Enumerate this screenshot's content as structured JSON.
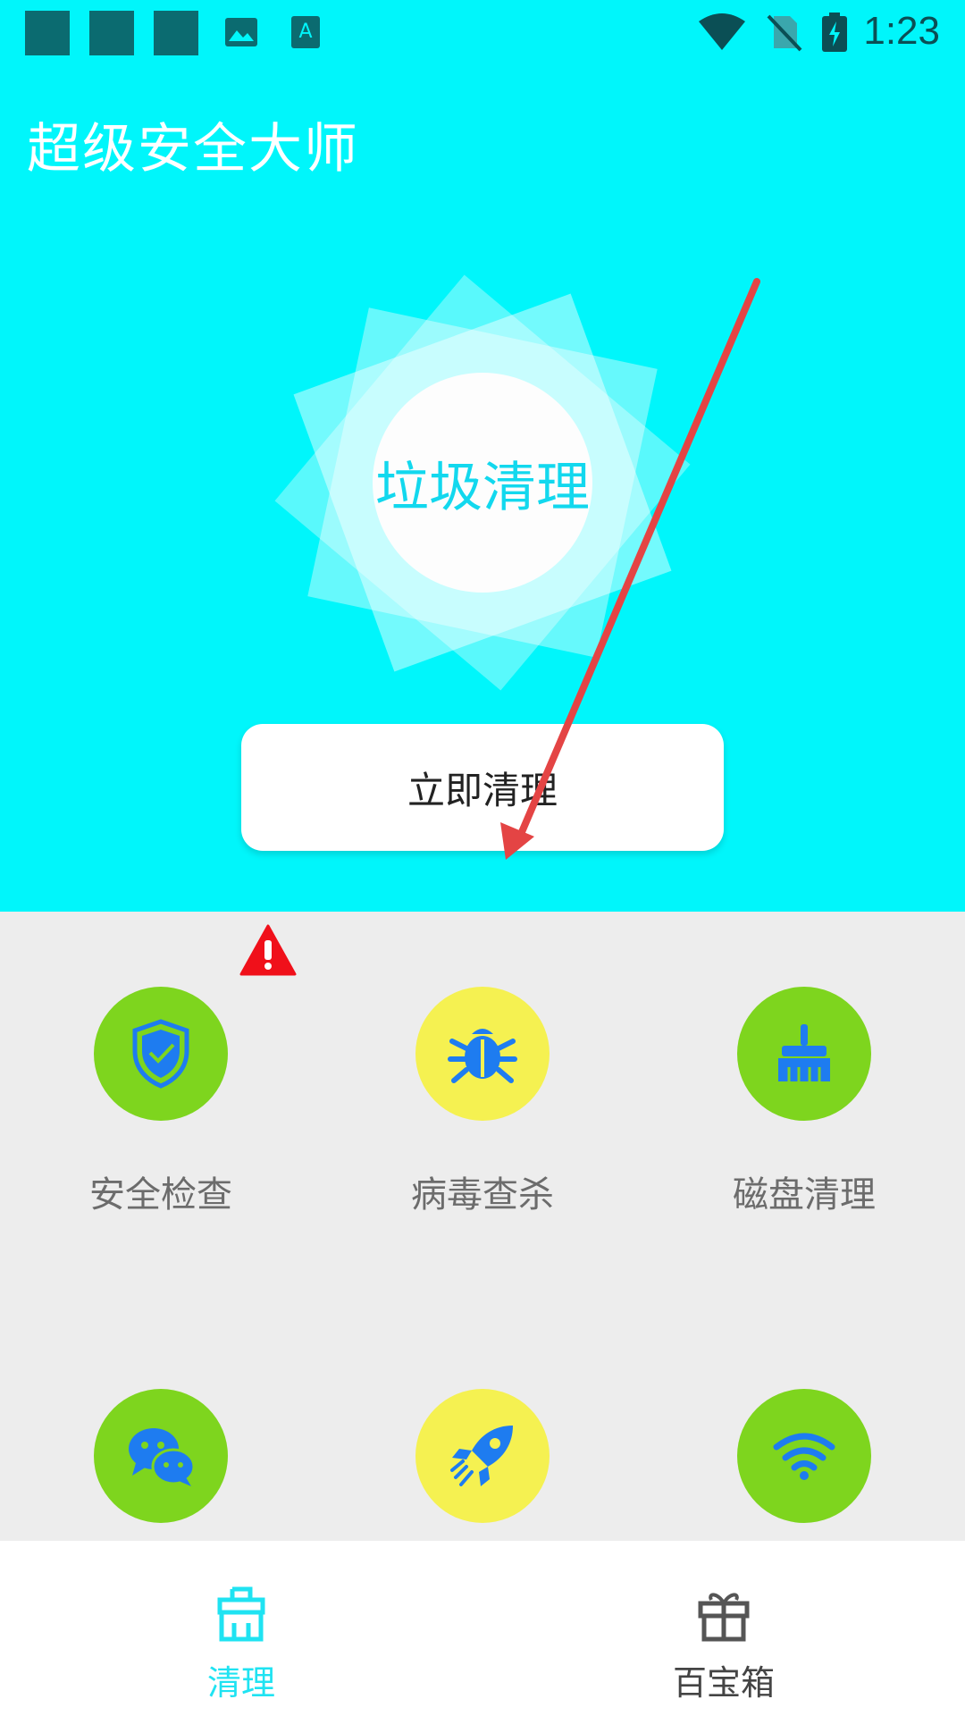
{
  "status_bar": {
    "time": "1:23",
    "icons": [
      "notification-square-icon",
      "notification-square-icon",
      "notification-square-icon",
      "image-icon",
      "font-icon",
      "wifi-icon",
      "no-sim-icon",
      "battery-charging-icon"
    ]
  },
  "header": {
    "app_title": "超级安全大师"
  },
  "hero": {
    "core_label": "垃圾清理",
    "clean_button_label": "立即清理"
  },
  "tools": [
    {
      "label": "安全检查",
      "icon": "shield-check-icon",
      "color": "#7ed51e"
    },
    {
      "label": "病毒查杀",
      "icon": "bug-icon",
      "color": "#f5f151"
    },
    {
      "label": "磁盘清理",
      "icon": "broom-icon",
      "color": "#7ed51e"
    },
    {
      "label": "",
      "icon": "chat-icon",
      "color": "#7ed51e"
    },
    {
      "label": "",
      "icon": "rocket-icon",
      "color": "#f5f151"
    },
    {
      "label": "",
      "icon": "wifi-icon",
      "color": "#7ed51e"
    }
  ],
  "nav": {
    "items": [
      {
        "label": "清理",
        "icon": "broom-icon",
        "active": true
      },
      {
        "label": "百宝箱",
        "icon": "gift-icon",
        "active": false
      }
    ]
  },
  "colors": {
    "primary": "#00f6fb",
    "accent_text": "#12d8ee",
    "green": "#7ed51e",
    "yellow": "#f5f151",
    "icon_blue": "#1e7cf0",
    "warning_red": "#f0101a",
    "arrow_red": "#e44444"
  }
}
